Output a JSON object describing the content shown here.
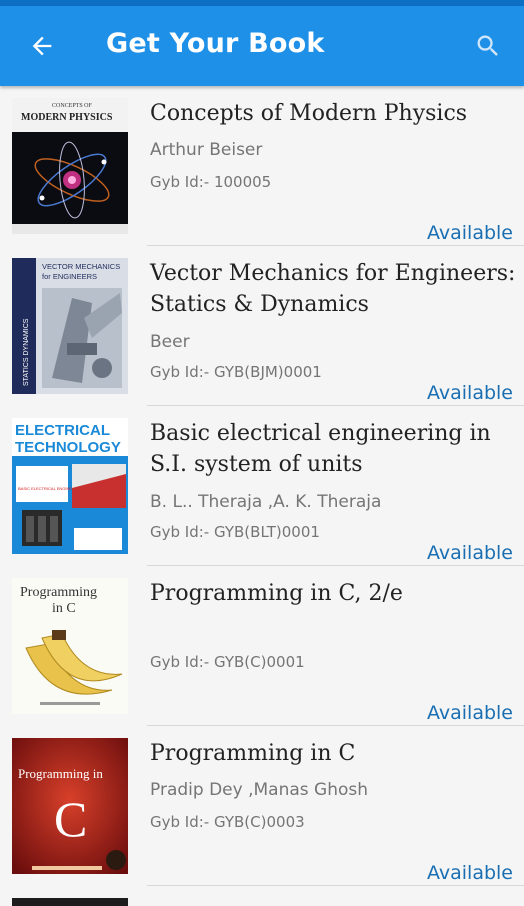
{
  "header": {
    "title": "Get Your Book",
    "back_icon": "arrow-back-icon",
    "search_icon": "search-icon",
    "bar_color": "#1e90e8",
    "status_bar_color": "#0d6fc4"
  },
  "colors": {
    "available": "#1a6fb3",
    "title": "#222222",
    "meta": "#757575"
  },
  "books": [
    {
      "title": "Concepts of Modern Physics",
      "author": "Arthur Beiser",
      "gyb_id": "Gyb Id:- 100005",
      "status": "Available",
      "cover_text": [
        "CONCEPTS OF",
        "MODERN PHYSICS"
      ]
    },
    {
      "title": "Vector Mechanics for Engineers: Statics & Dynamics",
      "author": "Beer",
      "gyb_id": "Gyb Id:- GYB(BJM)0001",
      "status": "Available",
      "cover_text": [
        "VECTOR MECHANICS",
        "for ENGINEERS",
        "STATICS DYNAMICS"
      ]
    },
    {
      "title": "Basic electrical engineering in S.I. system of units",
      "author": "B. L.. Theraja ,A. K. Theraja",
      "gyb_id": "Gyb Id:- GYB(BLT)0001",
      "status": "Available",
      "cover_text": [
        "ELECTRICAL",
        "TECHNOLOGY",
        "BASIC ELECTRICAL ENGINEERING"
      ]
    },
    {
      "title": "Programming in C, 2/e",
      "author": "",
      "gyb_id": "Gyb Id:- GYB(C)0001",
      "status": "Available",
      "cover_text": [
        "Programming",
        "in C"
      ]
    },
    {
      "title": "Programming in C",
      "author": "Pradip Dey ,Manas Ghosh",
      "gyb_id": "Gyb Id:- GYB(C)0003",
      "status": "Available",
      "cover_text": [
        "Programming in",
        "C"
      ]
    }
  ]
}
